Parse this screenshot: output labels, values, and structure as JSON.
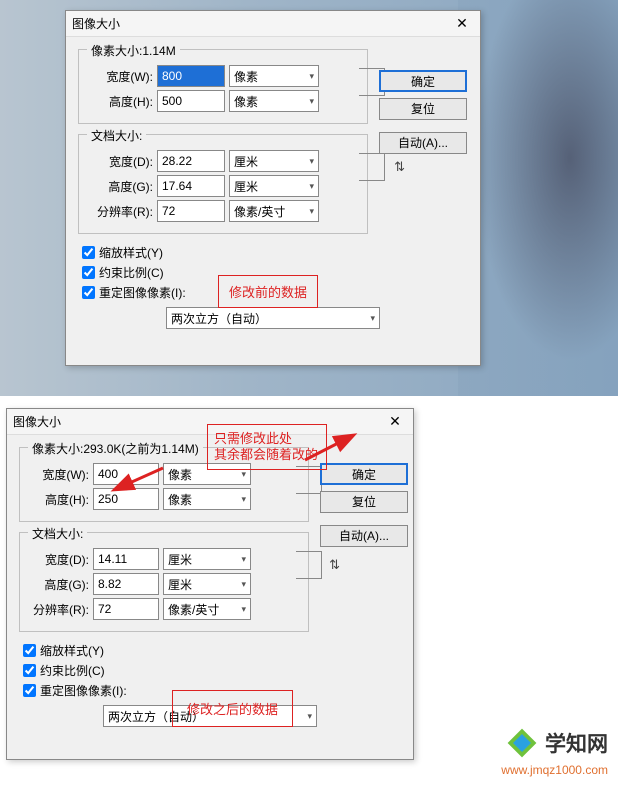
{
  "dialog1": {
    "title": "图像大小",
    "pixel_legend": "像素大小:1.14M",
    "doc_legend": "文档大小:",
    "width_w_label": "宽度(W):",
    "width_w_value": "800",
    "height_h_label": "高度(H):",
    "height_h_value": "500",
    "unit_pixel": "像素",
    "width_d_label": "宽度(D):",
    "width_d_value": "28.22",
    "height_g_label": "高度(G):",
    "height_g_value": "17.64",
    "unit_cm": "厘米",
    "res_label": "分辨率(R):",
    "res_value": "72",
    "unit_ppi": "像素/英寸",
    "scale_styles": "缩放样式(Y)",
    "constrain": "约束比例(C)",
    "resample": "重定图像像素(I):",
    "resample_method": "两次立方（自动）",
    "ok": "确定",
    "reset": "复位",
    "auto": "自动(A)..."
  },
  "dialog2": {
    "title": "图像大小",
    "pixel_legend": "像素大小:293.0K(之前为1.14M)",
    "doc_legend": "文档大小:",
    "width_w_label": "宽度(W):",
    "width_w_value": "400",
    "height_h_label": "高度(H):",
    "height_h_value": "250",
    "unit_pixel": "像素",
    "width_d_label": "宽度(D):",
    "width_d_value": "14.11",
    "height_g_label": "高度(G):",
    "height_g_value": "8.82",
    "unit_cm": "厘米",
    "res_label": "分辨率(R):",
    "res_value": "72",
    "unit_ppi": "像素/英寸",
    "scale_styles": "缩放样式(Y)",
    "constrain": "约束比例(C)",
    "resample": "重定图像像素(I):",
    "resample_method": "两次立方（自动）",
    "ok": "确定",
    "reset": "复位",
    "auto": "自动(A)..."
  },
  "notes": {
    "before": "修改前的数据",
    "hint_line1": "只需修改此处",
    "hint_line2": "其余都会随着改的",
    "after": "修改之后的数据"
  },
  "watermark": {
    "brand": "学知网",
    "url": "www.jmqz1000.com"
  }
}
